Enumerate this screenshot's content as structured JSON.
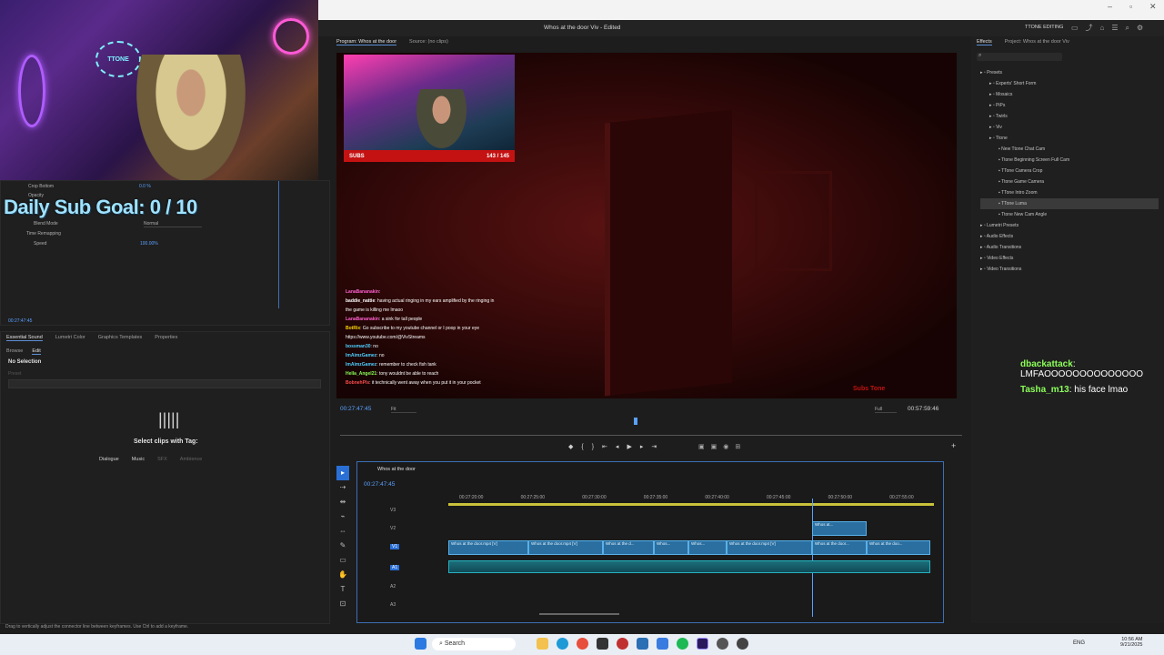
{
  "window": {
    "title": "Whos at the door Viv - Edited",
    "workspace": "TTONE EDITING"
  },
  "stream": {
    "subgoal_label": "Daily Sub Goal:",
    "subgoal_value": "0 / 10",
    "subs_label": "SUBS",
    "subs_count": "143 / 145"
  },
  "effect_controls": {
    "rows": [
      {
        "label": "Crop Bottom",
        "value": "0.0 %"
      },
      {
        "label": "Opacity",
        "value": ""
      },
      {
        "label": "Blend Mode",
        "value": "Normal"
      },
      {
        "label": "Time Remapping",
        "value": ""
      },
      {
        "label": "Speed",
        "value": "100.00%"
      }
    ],
    "timecode": "00:27:47:45"
  },
  "essential_sound": {
    "tabs": [
      "Essential Sound",
      "Lumetri Color",
      "Graphics Templates",
      "Properties"
    ],
    "subtabs": [
      "Browse",
      "Edit"
    ],
    "no_selection": "No Selection",
    "preset_label": "Preset",
    "select_clips": "Select clips with Tag:",
    "tags": [
      "Dialogue",
      "Music",
      "SFX",
      "Ambience"
    ]
  },
  "program_monitor": {
    "tab_program": "Program: Whos at the door",
    "tab_source": "Source: (no clips)",
    "timecode": "00:27:47:45",
    "fit": "Fit",
    "quality": "Full",
    "duration": "00:57:59:46",
    "watermark": "Subs Tone"
  },
  "chat": [
    {
      "name": "LanaBananakin",
      "msg": ":",
      "color": "#ff5fd0"
    },
    {
      "name": "baddie_nattie",
      "msg": ": having actual ringing in my ears amplified by the ringing in the game is killing me lmaoo",
      "color": "#ffffff"
    },
    {
      "name": "LanaBananakin",
      "msg": ": a sink for tall people",
      "color": "#ff5fd0"
    },
    {
      "name": "BotRix",
      "msg": ": Go subscribe to my youtube channel or I poop in your eye https://www.youtube.com/@VivStreams",
      "color": "#ffd400"
    },
    {
      "name": "bossman30",
      "msg": ": no",
      "color": "#4fd0ff"
    },
    {
      "name": "ImAimzGamez",
      "msg": ": no",
      "color": "#4fd0ff"
    },
    {
      "name": "ImAimzGamez",
      "msg": ": remember to check fish tank",
      "color": "#4fd0ff"
    },
    {
      "name": "Hella_Angel21",
      "msg": ": tony wouldnt be able to reach",
      "color": "#8cff5a"
    },
    {
      "name": "BobnehPls",
      "msg": ": it technically went away when you put it in your pocket",
      "color": "#ff4d4d"
    }
  ],
  "timeline": {
    "sequence": "Whos at the door",
    "timecode": "00:27:47:45",
    "ruler": [
      "00:27:20:00",
      "00:27:25:00",
      "00:27:30:00",
      "00:27:35:00",
      "00:27:40:00",
      "00:27:45:00",
      "00:27:50:00",
      "00:27:55:00"
    ],
    "tracks": [
      "V3",
      "V2",
      "V1",
      "A1",
      "A2",
      "A3"
    ],
    "v2_clip": "Whos at...",
    "v1_clips": [
      "Whos at the door.mp4 [V]",
      "Whos at the door.mp4 [V]",
      "Whos at the d...",
      "Whos...",
      "Whos...",
      "Whos at the door.mp4 [V]",
      "Whos at the door...",
      "Whos at the doo..."
    ],
    "status": "Drag to vertically adjust the connector line between keyframes. Use Ctrl to add a keyframe."
  },
  "effects_panel": {
    "tabs": [
      "Effects",
      "Project: Whos at the door Viv"
    ],
    "tree": [
      {
        "label": "Presets",
        "level": 0
      },
      {
        "label": "Experts' Short Form",
        "level": 1
      },
      {
        "label": "Mosaics",
        "level": 1
      },
      {
        "label": "PiPs",
        "level": 1
      },
      {
        "label": "Twirls",
        "level": 1
      },
      {
        "label": "Viv",
        "level": 1
      },
      {
        "label": "Ttone",
        "level": 1
      },
      {
        "label": "New Ttone Chat Cam",
        "level": 2
      },
      {
        "label": "Ttone Beginning Screen Full Cam",
        "level": 2
      },
      {
        "label": "TTone Camera Crop",
        "level": 2
      },
      {
        "label": "Ttone Game Camera",
        "level": 2
      },
      {
        "label": "TTone Intro Zoom",
        "level": 2
      },
      {
        "label": "TTone Luma",
        "level": 2
      },
      {
        "label": "Ttone New Cam Angle",
        "level": 2
      },
      {
        "label": "Lumetri Presets",
        "level": 0
      },
      {
        "label": "Audio Effects",
        "level": 0
      },
      {
        "label": "Audio Transitions",
        "level": 0
      },
      {
        "label": "Video Effects",
        "level": 0
      },
      {
        "label": "Video Transitions",
        "level": 0
      }
    ]
  },
  "overlay_chat": [
    {
      "name": "dbackattack",
      "msg": ": LMFAOOOOOOOOOOOOOO",
      "color": "#8cff5a"
    },
    {
      "name": "Tasha_m13",
      "msg": ": his face lmao",
      "color": "#8cff5a"
    }
  ],
  "taskbar": {
    "search": "Search",
    "lang": "ENG",
    "time": "10:56 AM",
    "date": "9/21/2025"
  }
}
